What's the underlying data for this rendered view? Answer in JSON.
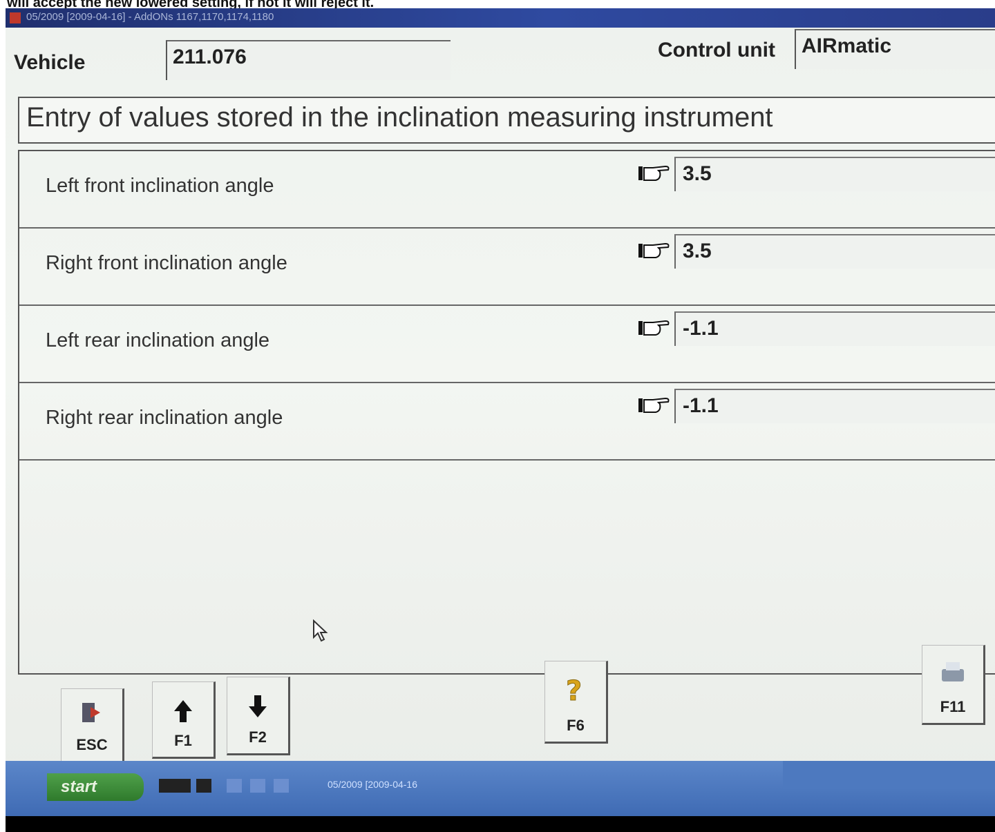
{
  "caption": "will accept the new lowered setting, if not it will reject it.",
  "window": {
    "title": "05/2009 [2009-04-16] - AddONs 1167,1170,1174,1180"
  },
  "header": {
    "vehicle_label": "Vehicle",
    "vehicle_value": "211.076",
    "control_unit_label": "Control unit",
    "control_unit_value": "AIRmatic"
  },
  "heading": "Entry of values stored in the inclination measuring instrument",
  "rows": [
    {
      "label": "Left front inclination angle",
      "value": "3.5"
    },
    {
      "label": "Right front inclination angle",
      "value": "3.5"
    },
    {
      "label": "Left rear inclination angle",
      "value": "-1.1"
    },
    {
      "label": "Right rear inclination angle",
      "value": "-1.1"
    }
  ],
  "fkeys": {
    "esc": "ESC",
    "f1": "F1",
    "f2": "F2",
    "f6": "F6",
    "f11": "F11"
  },
  "taskbar": {
    "start": "start",
    "task_item": "05/2009 [2009-04-16"
  },
  "colors": {
    "titlebar": "#2f4aa0",
    "taskbar": "#4f7cc2",
    "start_button": "#3f8f3a"
  }
}
